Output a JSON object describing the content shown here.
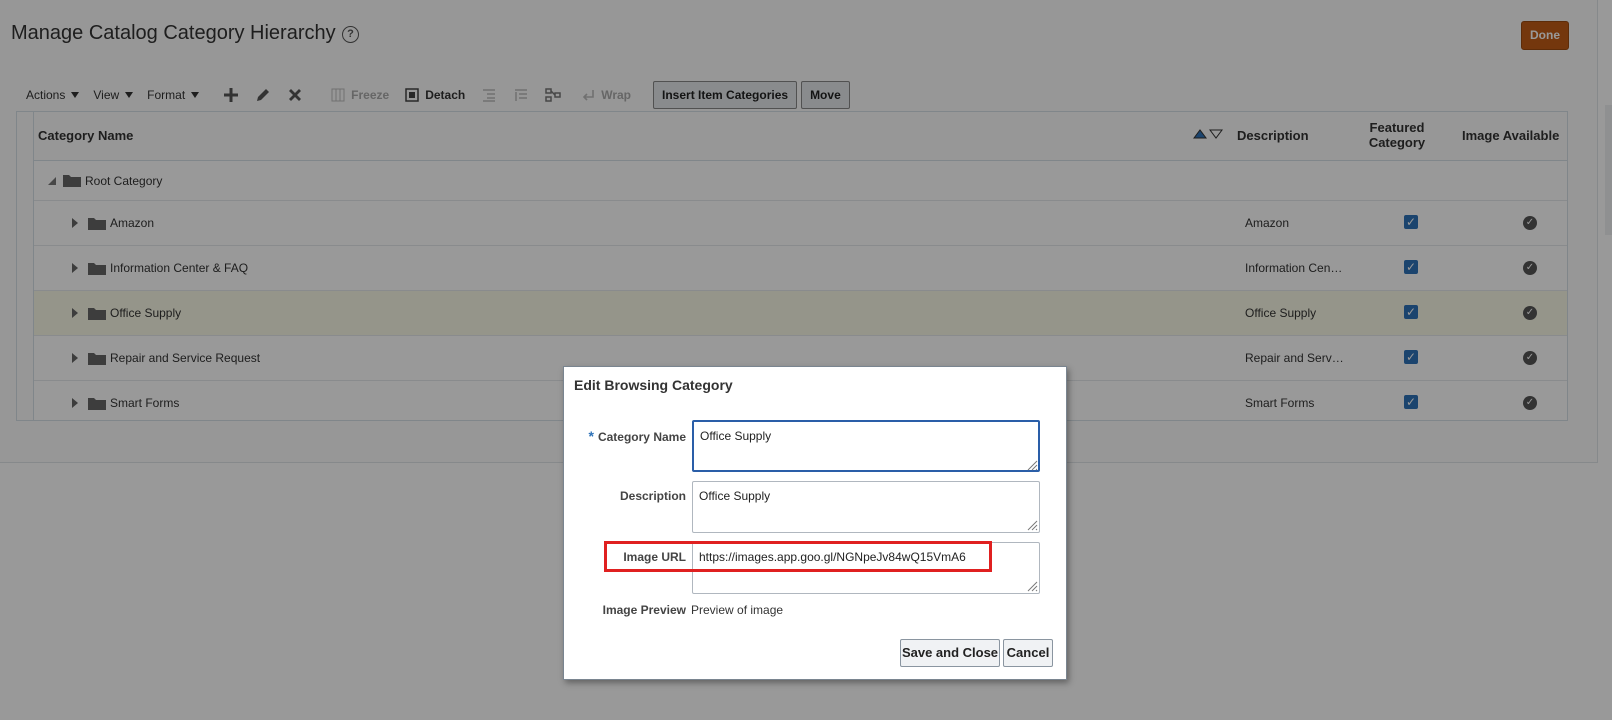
{
  "page": {
    "title": "Manage Catalog Category Hierarchy",
    "done_label": "Done"
  },
  "toolbar": {
    "menus": [
      "Actions",
      "View",
      "Format"
    ],
    "freeze_label": "Freeze",
    "detach_label": "Detach",
    "wrap_label": "Wrap",
    "insert_label": "Insert Item Categories",
    "move_label": "Move"
  },
  "table": {
    "headers": {
      "category_name": "Category Name",
      "description": "Description",
      "featured_1": "Featured",
      "featured_2": "Category",
      "image_available": "Image Available"
    },
    "root": "Root Category",
    "rows": [
      {
        "name": "Amazon",
        "description": "Amazon",
        "featured": true,
        "image": true
      },
      {
        "name": "Information Center & FAQ",
        "description": "Information Cen…",
        "featured": true,
        "image": true
      },
      {
        "name": "Office Supply",
        "description": "Office Supply",
        "featured": true,
        "image": true
      },
      {
        "name": "Repair and Service Request",
        "description": "Repair and Serv…",
        "featured": true,
        "image": true
      },
      {
        "name": "Smart Forms",
        "description": "Smart Forms",
        "featured": true,
        "image": true
      }
    ]
  },
  "dialog": {
    "title": "Edit Browsing Category",
    "required_marker": "*",
    "category_name_label": "Category Name",
    "category_name_value": "Office Supply",
    "description_label": "Description",
    "description_value": "Office Supply",
    "image_url_label": "Image URL",
    "image_url_value": "https://images.app.goo.gl/NGNpeJv84wQ15VmA6",
    "image_preview_label": "Image Preview",
    "image_preview_value": "Preview of image",
    "save_label": "Save and Close",
    "cancel_label": "Cancel"
  }
}
